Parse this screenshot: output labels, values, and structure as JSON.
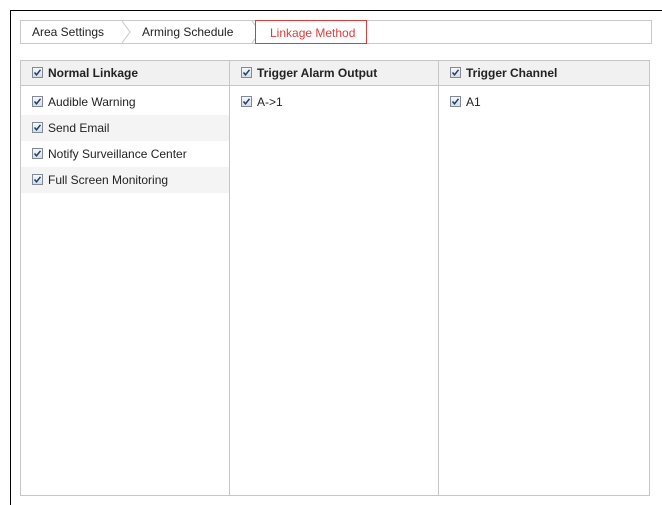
{
  "tabs": [
    {
      "label": "Area Settings",
      "active": false
    },
    {
      "label": "Arming Schedule",
      "active": false
    },
    {
      "label": "Linkage Method",
      "active": true
    }
  ],
  "columns": [
    {
      "header": "Normal Linkage",
      "header_checked": true,
      "items": [
        {
          "label": "Audible Warning",
          "checked": true
        },
        {
          "label": "Send Email",
          "checked": true
        },
        {
          "label": "Notify Surveillance Center",
          "checked": true
        },
        {
          "label": "Full Screen Monitoring",
          "checked": true
        }
      ]
    },
    {
      "header": "Trigger Alarm Output",
      "header_checked": true,
      "items": [
        {
          "label": "A->1",
          "checked": true
        }
      ]
    },
    {
      "header": "Trigger Channel",
      "header_checked": true,
      "items": [
        {
          "label": "A1",
          "checked": true
        }
      ]
    }
  ],
  "colors": {
    "active_tab": "#e03b3b",
    "border": "#c6c6c6",
    "header_bg": "#f1f1f1"
  },
  "icons": {
    "checkbox": "checked-checkbox-icon",
    "tab_separator": "chevron-right-icon"
  }
}
